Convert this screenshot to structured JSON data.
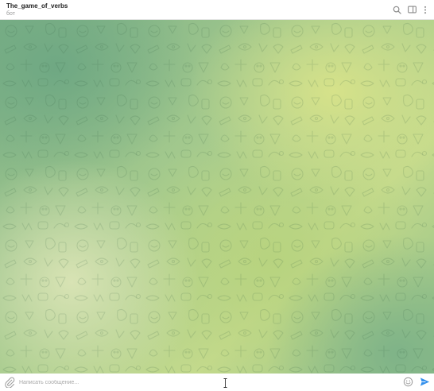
{
  "header": {
    "title": "The_game_of_verbs",
    "subtitle": "бот",
    "icons": [
      "search-icon",
      "sidebar-toggle-icon",
      "more-vertical-icon"
    ]
  },
  "chat": {
    "background_colors": [
      "#7aaf86",
      "#c4da8c",
      "#d8e3b4",
      "#d6e28a"
    ],
    "messages": []
  },
  "composer": {
    "placeholder": "Написать сообщение...",
    "value": "",
    "icons": [
      "paperclip-icon",
      "emoji-icon",
      "send-icon"
    ],
    "accent_color": "#3390ec"
  }
}
